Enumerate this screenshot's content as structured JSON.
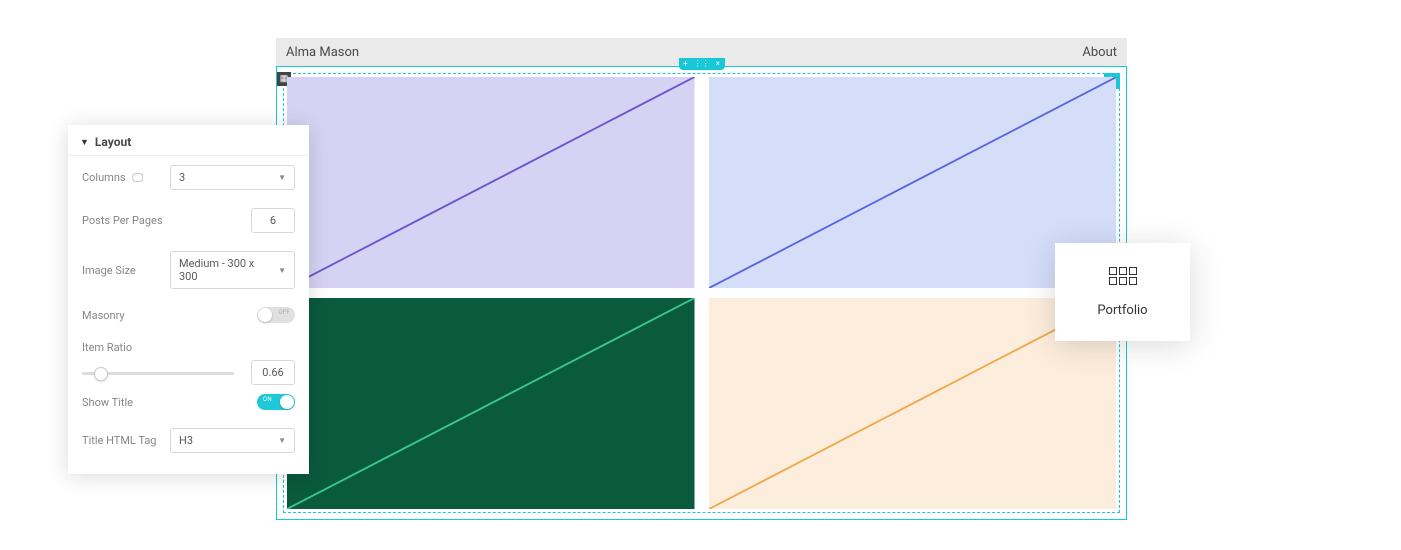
{
  "header": {
    "brand": "Alma Mason",
    "nav_about": "About"
  },
  "tiles": [
    {
      "fill": "#d6d2f3",
      "stroke": "#6a54cf"
    },
    {
      "fill": "#d4def9",
      "stroke": "#5a63df"
    },
    {
      "fill": "#0a5a3d",
      "stroke": "#39c98d"
    },
    {
      "fill": "#fceddc",
      "stroke": "#f0a84a"
    }
  ],
  "panel": {
    "title": "Layout",
    "columns_label": "Columns",
    "columns_value": "3",
    "posts_label": "Posts Per Pages",
    "posts_value": "6",
    "imgsize_label": "Image Size",
    "imgsize_value": "Medium - 300 x 300",
    "masonry_label": "Masonry",
    "masonry_off_text": "OFF",
    "ratio_label": "Item Ratio",
    "ratio_value": "0.66",
    "showtitle_label": "Show Title",
    "showtitle_on_text": "ON",
    "htmltag_label": "Title HTML Tag",
    "htmltag_value": "H3"
  },
  "widget": {
    "label": "Portfolio"
  }
}
